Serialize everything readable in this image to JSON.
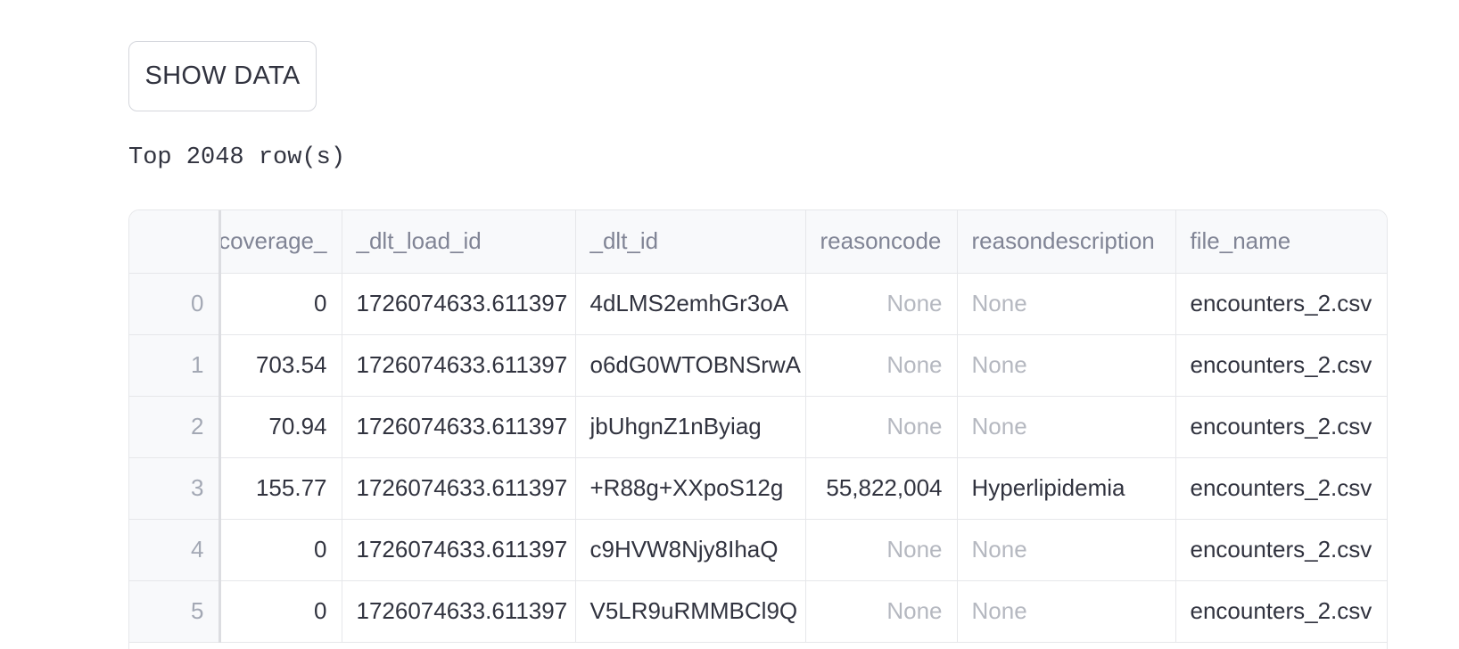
{
  "toolbar": {
    "show_data_label": "SHOW DATA"
  },
  "caption": "Top 2048 row(s)",
  "table": {
    "columns": {
      "index": "",
      "coverage": "_coverage",
      "dlt_load_id": "_dlt_load_id",
      "dlt_id": "_dlt_id",
      "reasoncode": "reasoncode",
      "reasondescription": "reasondescription",
      "file_name": "file_name"
    },
    "rows": [
      {
        "index": "0",
        "coverage": "0",
        "dlt_load_id": "1726074633.611397",
        "dlt_id": "4dLMS2emhGr3oA",
        "reasoncode": "None",
        "reasondescription": "None",
        "file_name": "encounters_2.csv"
      },
      {
        "index": "1",
        "coverage": "703.54",
        "dlt_load_id": "1726074633.611397",
        "dlt_id": "o6dG0WTOBNSrwA",
        "reasoncode": "None",
        "reasondescription": "None",
        "file_name": "encounters_2.csv"
      },
      {
        "index": "2",
        "coverage": "70.94",
        "dlt_load_id": "1726074633.611397",
        "dlt_id": "jbUhgnZ1nByiag",
        "reasoncode": "None",
        "reasondescription": "None",
        "file_name": "encounters_2.csv"
      },
      {
        "index": "3",
        "coverage": "155.77",
        "dlt_load_id": "1726074633.611397",
        "dlt_id": "+R88g+XXpoS12g",
        "reasoncode": "55,822,004",
        "reasondescription": "Hyperlipidemia",
        "file_name": "encounters_2.csv"
      },
      {
        "index": "4",
        "coverage": "0",
        "dlt_load_id": "1726074633.611397",
        "dlt_id": "c9HVW8Njy8IhaQ",
        "reasoncode": "None",
        "reasondescription": "None",
        "file_name": "encounters_2.csv"
      },
      {
        "index": "5",
        "coverage": "0",
        "dlt_load_id": "1726074633.611397",
        "dlt_id": "V5LR9uRMMBCl9Q",
        "reasoncode": "None",
        "reasondescription": "None",
        "file_name": "encounters_2.csv"
      }
    ]
  },
  "colors": {
    "text": "#31333f",
    "muted": "#808495",
    "none_value": "#b5b8c0",
    "border": "#e6e7ea",
    "header_bg": "#f8f9fb"
  }
}
